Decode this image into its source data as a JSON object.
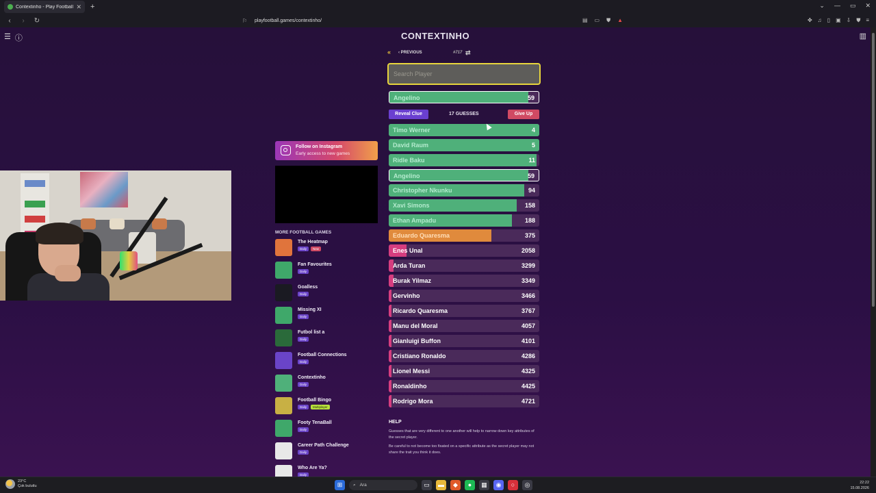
{
  "browser": {
    "tab_title": "Contextinho - Play Football Con",
    "tab_close": "✕",
    "new_tab": "+",
    "url": "playfootball.games/contextinho/",
    "window_controls": [
      "⌄",
      "—",
      "▭",
      "✕"
    ]
  },
  "site": {
    "title": "CONTEXTINHO",
    "previous_label": "PREVIOUS",
    "game_number": "#717",
    "search_placeholder": "Search Player",
    "reveal_clue": "Reveal Clue",
    "guesses_label": "17 GUESSES",
    "give_up": "Give Up"
  },
  "latest_guess": {
    "name": "Angelino",
    "rank": "59",
    "fill": 0.93,
    "color": "#4fb07a"
  },
  "guesses": [
    {
      "name": "Timo Werner",
      "rank": "4",
      "fill": 1.0,
      "color": "#4fb07a",
      "kind": "green",
      "highlight": false
    },
    {
      "name": "David Raum",
      "rank": "5",
      "fill": 1.0,
      "color": "#4fb07a",
      "kind": "green",
      "highlight": false
    },
    {
      "name": "Ridle Baku",
      "rank": "11",
      "fill": 0.98,
      "color": "#4fb07a",
      "kind": "green",
      "highlight": false
    },
    {
      "name": "Angelino",
      "rank": "59",
      "fill": 0.93,
      "color": "#4fb07a",
      "kind": "green",
      "highlight": true
    },
    {
      "name": "Christopher Nkunku",
      "rank": "94",
      "fill": 0.9,
      "color": "#4fb07a",
      "kind": "green",
      "highlight": false
    },
    {
      "name": "Xavi Simons",
      "rank": "158",
      "fill": 0.85,
      "color": "#4fb07a",
      "kind": "green",
      "highlight": false
    },
    {
      "name": "Ethan Ampadu",
      "rank": "188",
      "fill": 0.82,
      "color": "#4fb07a",
      "kind": "green",
      "highlight": false
    },
    {
      "name": "Eduardo Quaresma",
      "rank": "375",
      "fill": 0.68,
      "color": "#e08a3c",
      "kind": "orange",
      "highlight": false
    },
    {
      "name": "Enes Unal",
      "rank": "2058",
      "fill": 0.12,
      "color": "#d63d7f",
      "kind": "pink",
      "highlight": false
    },
    {
      "name": "Arda Turan",
      "rank": "3299",
      "fill": 0.03,
      "color": "#d63d7f",
      "kind": "pink",
      "highlight": false
    },
    {
      "name": "Burak Yilmaz",
      "rank": "3349",
      "fill": 0.03,
      "color": "#d63d7f",
      "kind": "pink",
      "highlight": false
    },
    {
      "name": "Gervinho",
      "rank": "3466",
      "fill": 0.02,
      "color": "#d63d7f",
      "kind": "pink",
      "highlight": false
    },
    {
      "name": "Ricardo Quaresma",
      "rank": "3767",
      "fill": 0.02,
      "color": "#d63d7f",
      "kind": "pink",
      "highlight": false
    },
    {
      "name": "Manu del Moral",
      "rank": "4057",
      "fill": 0.02,
      "color": "#d63d7f",
      "kind": "pink",
      "highlight": false
    },
    {
      "name": "Gianluigi Buffon",
      "rank": "4101",
      "fill": 0.02,
      "color": "#d63d7f",
      "kind": "pink",
      "highlight": false
    },
    {
      "name": "Cristiano Ronaldo",
      "rank": "4286",
      "fill": 0.02,
      "color": "#d63d7f",
      "kind": "pink",
      "highlight": false
    },
    {
      "name": "Lionel Messi",
      "rank": "4325",
      "fill": 0.02,
      "color": "#d63d7f",
      "kind": "pink",
      "highlight": false
    },
    {
      "name": "Ronaldinho",
      "rank": "4425",
      "fill": 0.02,
      "color": "#d63d7f",
      "kind": "pink",
      "highlight": false
    },
    {
      "name": "Rodrigo Mora",
      "rank": "4721",
      "fill": 0.02,
      "color": "#d63d7f",
      "kind": "pink",
      "highlight": false
    }
  ],
  "help": {
    "title": "HELP",
    "p1": "Guesses that are very different to one another will help to narrow down key attributes of the secret player.",
    "p2": "Be careful to not become too fixated on a specific attribute as the secret player may not share the trait you think it does."
  },
  "instagram": {
    "title": "Follow on Instagram",
    "subtitle": "Early access to new games"
  },
  "more_games": {
    "title": "MORE FOOTBALL GAMES",
    "items": [
      {
        "name": "The Heatmap",
        "badges": [
          {
            "text": "Daily",
            "kind": "daily"
          },
          {
            "text": "New",
            "kind": "new"
          }
        ],
        "icon_color": "#e0743c"
      },
      {
        "name": "Fan Favourites",
        "badges": [
          {
            "text": "Daily",
            "kind": "daily"
          }
        ],
        "icon_color": "#3fa86a"
      },
      {
        "name": "Goalless",
        "badges": [
          {
            "text": "Daily",
            "kind": "daily"
          }
        ],
        "icon_color": "#1a1a22"
      },
      {
        "name": "Missing XI",
        "badges": [
          {
            "text": "Daily",
            "kind": "daily"
          }
        ],
        "icon_color": "#3fa86a"
      },
      {
        "name": "Futbol list a",
        "badges": [
          {
            "text": "Daily",
            "kind": "daily"
          }
        ],
        "icon_color": "#2a6a3a"
      },
      {
        "name": "Football Connections",
        "badges": [
          {
            "text": "Daily",
            "kind": "daily"
          }
        ],
        "icon_color": "#6a44c8"
      },
      {
        "name": "Contextinho",
        "badges": [
          {
            "text": "Daily",
            "kind": "daily"
          }
        ],
        "icon_color": "#4fb07a"
      },
      {
        "name": "Football Bingo",
        "badges": [
          {
            "text": "Daily",
            "kind": "daily"
          },
          {
            "text": "Multiplayer",
            "kind": "multi"
          }
        ],
        "icon_color": "#c8b044"
      },
      {
        "name": "Footy TenaBall",
        "badges": [
          {
            "text": "Daily",
            "kind": "daily"
          }
        ],
        "icon_color": "#3fa86a"
      },
      {
        "name": "Career Path Challenge",
        "badges": [
          {
            "text": "Daily",
            "kind": "daily"
          }
        ],
        "icon_color": "#e8e8e8"
      },
      {
        "name": "Who Are Ya?",
        "badges": [
          {
            "text": "Daily",
            "kind": "daily"
          }
        ],
        "icon_color": "#e8e8e8"
      }
    ]
  },
  "taskbar": {
    "temperature": "23°C",
    "weather_text": "Çok bulutlu",
    "search_label": "Ara",
    "time": "22:22",
    "date": "15.08.2026"
  }
}
